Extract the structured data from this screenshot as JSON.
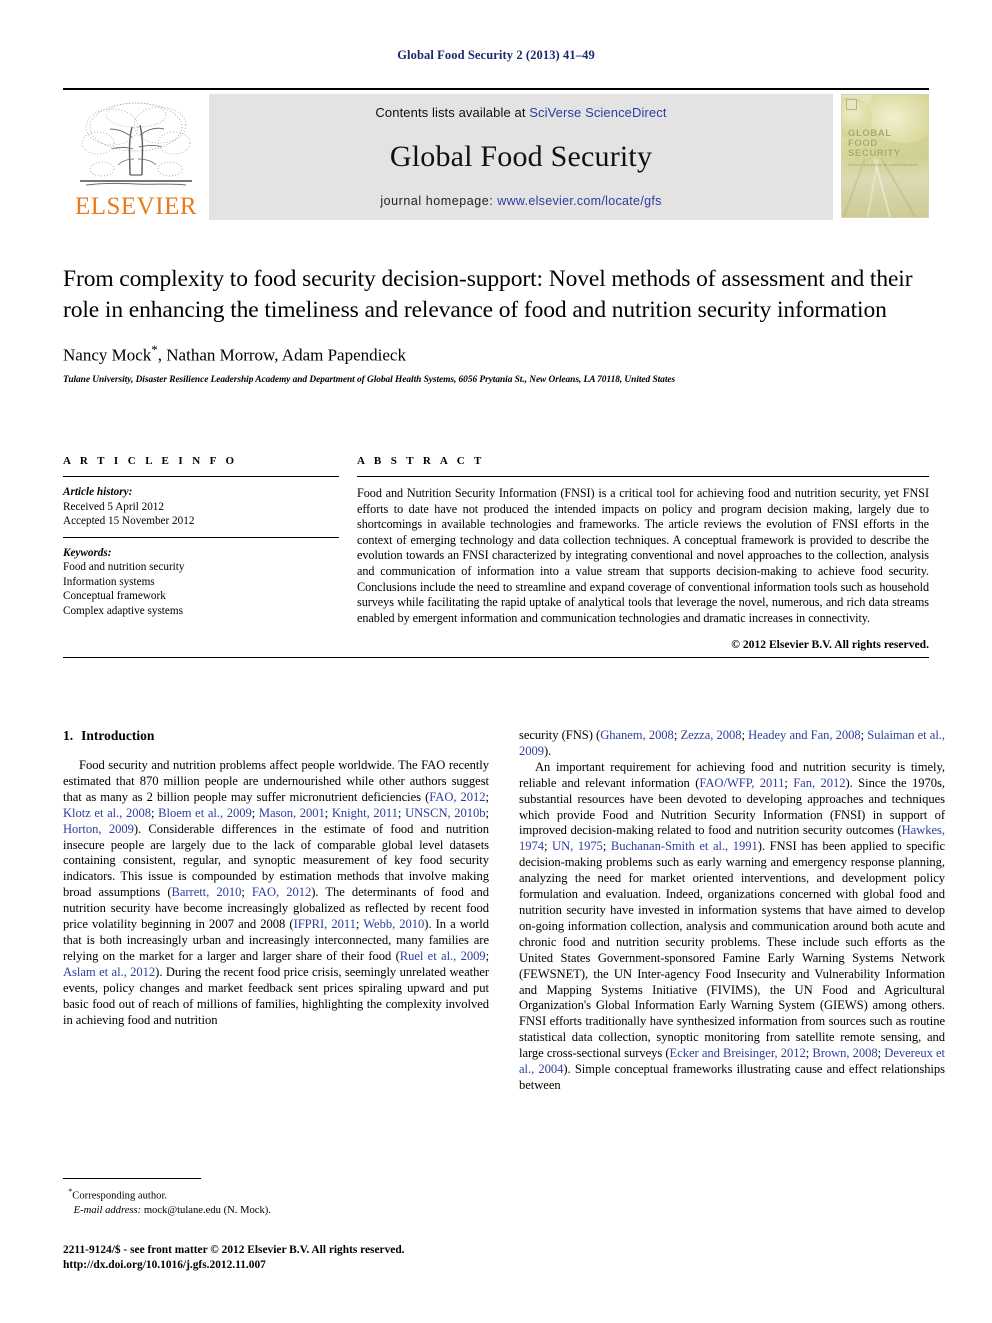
{
  "running_head": "Global Food Security 2 (2013) 41–49",
  "masthead": {
    "contents_prefix": "Contents lists available at ",
    "contents_link": "SciVerse ScienceDirect",
    "journal_title": "Global Food Security",
    "homepage_prefix": "journal homepage: ",
    "homepage_url": "www.elsevier.com/locate/gfs",
    "publisher_wordmark": "ELSEVIER",
    "cover_title_lines": [
      "GLOBAL",
      "FOOD",
      "SECURITY"
    ],
    "cover_subtitle": "Science and policy for a well-fed world"
  },
  "article": {
    "title": "From complexity to food security decision-support: Novel methods of assessment and their role in enhancing the timeliness and relevance of food and nutrition security information",
    "authors": "Nancy Mock",
    "authors_rest": ", Nathan Morrow, Adam Papendieck",
    "author_marker": "*",
    "affiliation": "Tulane University, Disaster Resilience Leadership Academy and Department of Global Health Systems, 6056 Prytania St., New Orleans, LA 70118, United States"
  },
  "article_info": {
    "heading": "A R T I C L E   I N F O",
    "history_label": "Article history:",
    "received": "Received 5 April 2012",
    "accepted": "Accepted 15 November 2012",
    "keywords_label": "Keywords:",
    "keywords": [
      "Food and nutrition security",
      "Information systems",
      "Conceptual framework",
      "Complex adaptive systems"
    ]
  },
  "abstract": {
    "heading": "A B S T R A C T",
    "text": "Food and Nutrition Security Information (FNSI) is a critical tool for achieving food and nutrition security, yet FNSI efforts to date have not produced the intended impacts on policy and program decision making, largely due to shortcomings in available technologies and frameworks. The article reviews the evolution of FNSI efforts in the context of emerging technology and data collection techniques. A conceptual framework is provided to describe the evolution towards an FNSI characterized by integrating conventional and novel approaches to the collection, analysis and communication of information into a value stream that supports decision-making to achieve food security. Conclusions include the need to streamline and expand coverage of conventional information tools such as household surveys while facilitating the rapid uptake of analytical tools that leverage the novel, numerous, and rich data streams enabled by emergent information and communication technologies and dramatic increases in connectivity.",
    "copyright": "© 2012 Elsevier B.V. All rights reserved."
  },
  "section": {
    "number": "1.",
    "title": "Introduction"
  },
  "body": {
    "left_para_1": [
      {
        "t": "Food security and nutrition problems affect people worldwide. The FAO recently estimated that 870 million people are undernourished while other authors suggest that as many as 2 billion people may suffer micronutrient deficiencies ("
      },
      {
        "t": "FAO, 2012",
        "c": true
      },
      {
        "t": "; "
      },
      {
        "t": "Klotz et al., 2008",
        "c": true
      },
      {
        "t": "; "
      },
      {
        "t": "Bloem et al., 2009",
        "c": true
      },
      {
        "t": "; "
      },
      {
        "t": "Mason, 2001",
        "c": true
      },
      {
        "t": "; "
      },
      {
        "t": "Knight, 2011",
        "c": true
      },
      {
        "t": "; "
      },
      {
        "t": "UNSCN, 2010b",
        "c": true
      },
      {
        "t": "; "
      },
      {
        "t": "Horton, 2009",
        "c": true
      },
      {
        "t": "). Considerable differences in the estimate of food and nutrition insecure people are largely due to the lack of comparable global level datasets containing consistent, regular, and synoptic measurement of key food security indicators. This issue is compounded by estimation methods that involve making broad assumptions ("
      },
      {
        "t": "Barrett, 2010",
        "c": true
      },
      {
        "t": "; "
      },
      {
        "t": "FAO, 2012",
        "c": true
      },
      {
        "t": "). The determinants of food and nutrition security have become increasingly globalized as reflected by recent food price volatility beginning in 2007 and 2008 ("
      },
      {
        "t": "IFPRI, 2011",
        "c": true
      },
      {
        "t": "; "
      },
      {
        "t": "Webb, 2010",
        "c": true
      },
      {
        "t": "). In a world that is both increasingly urban and increasingly interconnected, many families are relying on the market for a larger and larger share of their food ("
      },
      {
        "t": "Ruel et al., 2009",
        "c": true
      },
      {
        "t": "; "
      },
      {
        "t": "Aslam et al., 2012",
        "c": true
      },
      {
        "t": "). During the recent food price crisis, seemingly unrelated weather events, policy changes and market feedback sent prices spiraling upward and put basic food out of reach of millions of families, highlighting the complexity involved in achieving food and nutrition"
      }
    ],
    "right_para_1_cont": [
      {
        "t": "security (FNS) ("
      },
      {
        "t": "Ghanem, 2008",
        "c": true
      },
      {
        "t": "; "
      },
      {
        "t": "Zezza, 2008",
        "c": true
      },
      {
        "t": "; "
      },
      {
        "t": "Headey and Fan, 2008",
        "c": true
      },
      {
        "t": "; "
      },
      {
        "t": "Sulaiman et al., 2009",
        "c": true
      },
      {
        "t": ")."
      }
    ],
    "right_para_2": [
      {
        "t": "An important requirement for achieving food and nutrition security is timely, reliable and relevant information ("
      },
      {
        "t": "FAO/WFP, 2011",
        "c": true
      },
      {
        "t": "; "
      },
      {
        "t": "Fan, 2012",
        "c": true
      },
      {
        "t": "). Since the 1970s, substantial resources have been devoted to developing approaches and techniques which provide Food and Nutrition Security Information (FNSI) in support of improved decision-making related to food and nutrition security outcomes ("
      },
      {
        "t": "Hawkes, 1974",
        "c": true
      },
      {
        "t": "; "
      },
      {
        "t": "UN, 1975",
        "c": true
      },
      {
        "t": "; "
      },
      {
        "t": "Buchanan-Smith et al., 1991",
        "c": true
      },
      {
        "t": "). FNSI has been applied to specific decision-making problems such as early warning and emergency response planning, analyzing the need for market oriented interventions, and development policy formulation and evaluation. Indeed, organizations concerned with global food and nutrition security have invested in information systems that have aimed to develop on-going information collection, analysis and communication around both acute and chronic food and nutrition security problems. These include such efforts as the United States Government-sponsored Famine Early Warning Systems Network (FEWSNET), the UN Inter-agency Food Insecurity and Vulnerability Information and Mapping Systems Initiative (FIVIMS), the UN Food and Agricultural Organization's Global Information Early Warning System (GIEWS) among others. FNSI efforts traditionally have synthesized information from sources such as routine statistical data collection, synoptic monitoring from satellite remote sensing, and large cross-sectional surveys ("
      },
      {
        "t": "Ecker and Breisinger, 2012",
        "c": true
      },
      {
        "t": "; "
      },
      {
        "t": "Brown, 2008",
        "c": true
      },
      {
        "t": "; "
      },
      {
        "t": "Devereux et al., 2004",
        "c": true
      },
      {
        "t": "). Simple conceptual frameworks illustrating cause and effect relationships between"
      }
    ]
  },
  "footnote": {
    "corresponding_marker": "*",
    "corresponding_label": "Corresponding author.",
    "email_label": "E-mail address:",
    "email_value": " mock@tulane.edu (N. Mock)."
  },
  "footer": {
    "issn_line": "2211-9124/$ - see front matter © 2012 Elsevier B.V. All rights reserved.",
    "doi_line": "http://dx.doi.org/10.1016/j.gfs.2012.11.007"
  },
  "colors": {
    "link": "#2d3ea0",
    "running_head": "#1a2b6d",
    "elsevier_orange": "#e87b1e",
    "banner_gray": "#e3e3e3"
  }
}
